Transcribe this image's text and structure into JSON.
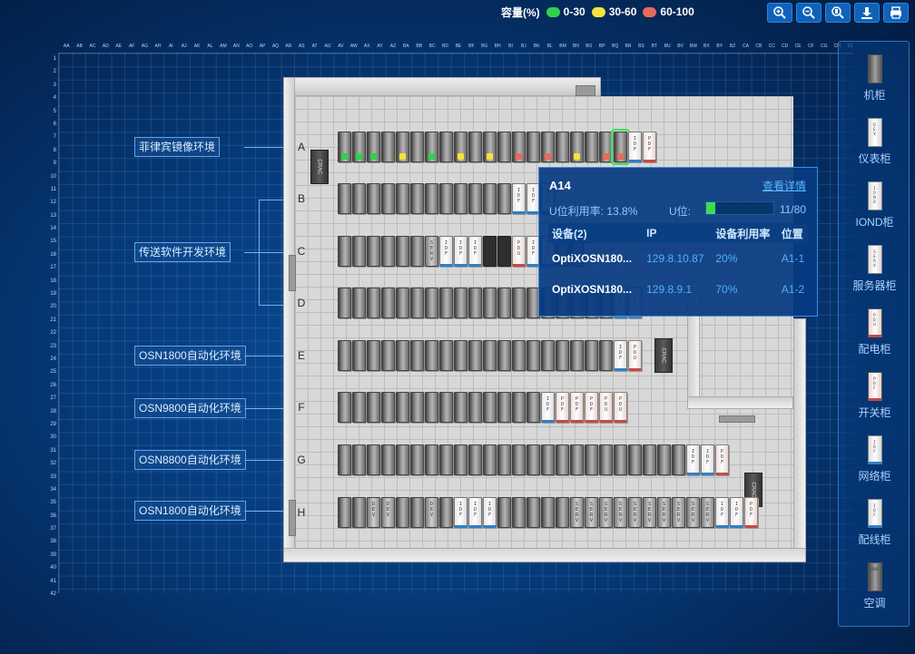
{
  "legend": {
    "title": "容量(%)",
    "items": [
      {
        "label": "0-30",
        "color": "#2fd24d"
      },
      {
        "label": "30-60",
        "color": "#f5e43a"
      },
      {
        "label": "60-100",
        "color": "#ea6a5a"
      }
    ]
  },
  "toolbar": [
    {
      "name": "zoom-in-icon"
    },
    {
      "name": "zoom-out-icon"
    },
    {
      "name": "zoom-fit-icon"
    },
    {
      "name": "download-icon"
    },
    {
      "name": "print-icon"
    }
  ],
  "grid": {
    "col_labels": [
      "AA",
      "AB",
      "AC",
      "AD",
      "AE",
      "AF",
      "AG",
      "AH",
      "AI",
      "AJ",
      "AK",
      "AL",
      "AM",
      "AN",
      "AO",
      "AP",
      "AQ",
      "AR",
      "AS",
      "AT",
      "AU",
      "AV",
      "AW",
      "AX",
      "AY",
      "AZ",
      "BA",
      "BB",
      "BC",
      "BD",
      "BE",
      "BF",
      "BG",
      "BH",
      "BI",
      "BJ",
      "BK",
      "BL",
      "BM",
      "BN",
      "BO",
      "BP",
      "BQ",
      "BR",
      "BS",
      "BT",
      "BU",
      "BV",
      "BW",
      "BX",
      "BY",
      "BZ",
      "CA",
      "CB",
      "CC",
      "CD",
      "CE",
      "CF",
      "CG",
      "CH",
      "CI"
    ],
    "row_labels": [
      "1",
      "2",
      "3",
      "4",
      "5",
      "6",
      "7",
      "8",
      "9",
      "10",
      "11",
      "12",
      "13",
      "14",
      "15",
      "16",
      "17",
      "18",
      "19",
      "20",
      "21",
      "22",
      "23",
      "24",
      "25",
      "26",
      "27",
      "28",
      "29",
      "30",
      "31",
      "32",
      "33",
      "34",
      "35",
      "36",
      "37",
      "38",
      "39",
      "40",
      "41",
      "42"
    ]
  },
  "rows": [
    {
      "letter": "A"
    },
    {
      "letter": "B"
    },
    {
      "letter": "C"
    },
    {
      "letter": "D"
    },
    {
      "letter": "E"
    },
    {
      "letter": "F"
    },
    {
      "letter": "G"
    },
    {
      "letter": "H"
    }
  ],
  "rack_labels": {
    "idf": "I D F",
    "pdf": "P D F",
    "pdu": "P D U",
    "dev": "D E V",
    "serv": "S E R V",
    "crac": "CRAC"
  },
  "environments": [
    {
      "label": "菲律宾镜像环境"
    },
    {
      "label": "传送软件开发环境"
    },
    {
      "label": "OSN1800自动化环境"
    },
    {
      "label": "OSN9800自动化环境"
    },
    {
      "label": "OSN8800自动化环境"
    },
    {
      "label": "OSN1800自动化环境"
    }
  ],
  "sidebar": [
    {
      "label": "机柜",
      "icon": "cabinet-icon",
      "tag": ""
    },
    {
      "label": "仪表柜",
      "icon": "instrument-cabinet-icon",
      "tag": "D E V"
    },
    {
      "label": "IOND柜",
      "icon": "iond-cabinet-icon",
      "tag": "I O N D"
    },
    {
      "label": "服务器柜",
      "icon": "server-cabinet-icon",
      "tag": "S E R V"
    },
    {
      "label": "配电柜",
      "icon": "power-distribution-cabinet-icon",
      "tag": "P D U"
    },
    {
      "label": "开关柜",
      "icon": "switch-cabinet-icon",
      "tag": "P D F"
    },
    {
      "label": "网络柜",
      "icon": "network-cabinet-icon",
      "tag": "I D F"
    },
    {
      "label": "配线柜",
      "icon": "wiring-cabinet-icon",
      "tag": "I D F"
    },
    {
      "label": "空调",
      "icon": "air-conditioner-icon",
      "tag": "CRAC"
    }
  ],
  "popup": {
    "title": "A14",
    "detail_link": "查看详情",
    "u_rate_label": "U位利用率:",
    "u_rate_value": "13.8%",
    "u_pos_label": "U位:",
    "u_pos_value": "11/80",
    "u_fill_fraction": 0.1375,
    "columns": [
      "设备(2)",
      "IP",
      "设备利用率",
      "位置"
    ],
    "devices": [
      {
        "name": "OptiXOSN180...",
        "ip": "129.8.10.87",
        "usage": "20%",
        "position": "A1-1"
      },
      {
        "name": "OptiXOSN180...",
        "ip": "129.8.9.1",
        "usage": "70%",
        "position": "A1-2"
      }
    ]
  }
}
